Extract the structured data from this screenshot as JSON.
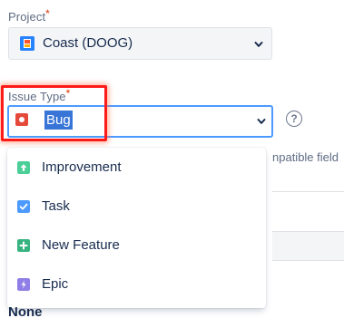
{
  "project": {
    "label": "Project",
    "required_mark": "*",
    "value": "Coast (DOOG)"
  },
  "issue_type": {
    "label": "Issue Type",
    "required_mark": "*",
    "value": "Bug",
    "help_symbol": "?"
  },
  "background": {
    "partial_text": "npatible field"
  },
  "dropdown": {
    "options": [
      {
        "label": "Improvement",
        "icon": "improvement-icon",
        "color": "#4bce97"
      },
      {
        "label": "Task",
        "icon": "task-icon",
        "color": "#4c9aff"
      },
      {
        "label": "New Feature",
        "icon": "new-feature-icon",
        "color": "#36b37e"
      },
      {
        "label": "Epic",
        "icon": "epic-icon",
        "color": "#8f7ee7"
      }
    ]
  },
  "footer": {
    "none_label": "None"
  },
  "colors": {
    "focus_border": "#4c9aff",
    "highlight_annotation": "#ff1a1a",
    "bug": "#e5493a",
    "selection": "#3875d7"
  }
}
